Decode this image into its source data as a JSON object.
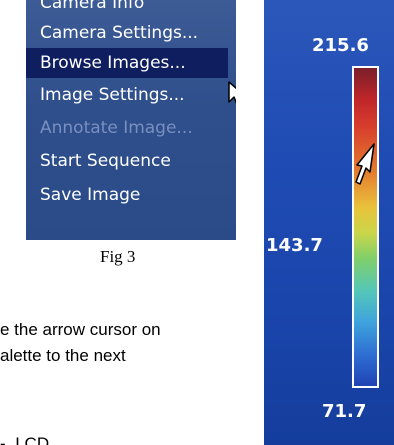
{
  "menu": {
    "items": [
      {
        "label": "Camera Info",
        "state": "normal"
      },
      {
        "label": "Camera Settings...",
        "state": "normal"
      },
      {
        "label": "Browse Images...",
        "state": "selected"
      },
      {
        "label": "Image Settings...",
        "state": "normal"
      },
      {
        "label": "Annotate Image...",
        "state": "disabled"
      },
      {
        "label": "Start Sequence",
        "state": "normal"
      },
      {
        "label": "Save Image",
        "state": "normal"
      }
    ],
    "cursor_icon": "arrow-cursor-icon"
  },
  "figure": {
    "caption": "Fig 3"
  },
  "body_text": {
    "line1": "e the arrow cursor on",
    "line2": "alette to the next",
    "line3": "-. I CD"
  },
  "palette": {
    "max_label": "215.6",
    "mid_label": "143.7",
    "min_label": "71.7",
    "cursor_icon": "arrow-cursor-icon",
    "colors": {
      "background": "#1f4cb4",
      "top": "#7a1f2a",
      "bottom": "#1f43b3"
    }
  }
}
